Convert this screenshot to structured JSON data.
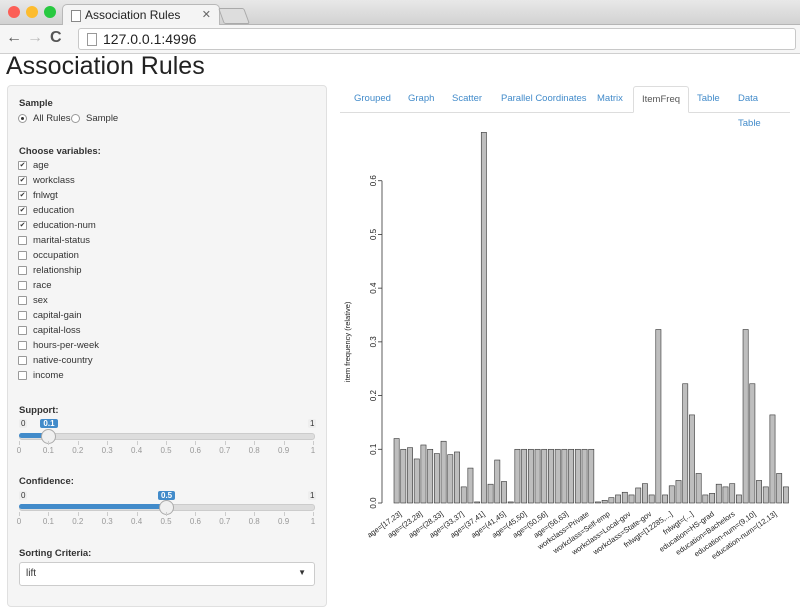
{
  "browser": {
    "tab_title": "Association Rules",
    "tab_close": "✕",
    "url": "127.0.0.1:4996",
    "back": "←",
    "forward": "→",
    "reload": "C"
  },
  "page_title": "Association Rules",
  "sidebar": {
    "sample": {
      "label": "Sample",
      "options": [
        "All Rules",
        "Sample"
      ],
      "selected": "All Rules"
    },
    "variables": {
      "label": "Choose variables:",
      "items": [
        {
          "label": "age",
          "checked": true
        },
        {
          "label": "workclass",
          "checked": true
        },
        {
          "label": "fnlwgt",
          "checked": true
        },
        {
          "label": "education",
          "checked": true
        },
        {
          "label": "education-num",
          "checked": true
        },
        {
          "label": "marital-status",
          "checked": false
        },
        {
          "label": "occupation",
          "checked": false
        },
        {
          "label": "relationship",
          "checked": false
        },
        {
          "label": "race",
          "checked": false
        },
        {
          "label": "sex",
          "checked": false
        },
        {
          "label": "capital-gain",
          "checked": false
        },
        {
          "label": "capital-loss",
          "checked": false
        },
        {
          "label": "hours-per-week",
          "checked": false
        },
        {
          "label": "native-country",
          "checked": false
        },
        {
          "label": "income",
          "checked": false
        }
      ]
    },
    "support": {
      "label": "Support:",
      "min": "0",
      "max": "1",
      "value": "0.1",
      "value_num": 0.1
    },
    "confidence": {
      "label": "Confidence:",
      "min": "0",
      "max": "1",
      "value": "0.5",
      "value_num": 0.5
    },
    "tick_labels": [
      "0",
      "0.1",
      "0.2",
      "0.3",
      "0.4",
      "0.5",
      "0.6",
      "0.7",
      "0.8",
      "0.9",
      "1"
    ],
    "sorting": {
      "label": "Sorting Criteria:",
      "value": "lift"
    }
  },
  "tabs": [
    {
      "label": "Grouped",
      "active": false
    },
    {
      "label": "Graph",
      "active": false
    },
    {
      "label": "Scatter",
      "active": false
    },
    {
      "label": "Parallel Coordinates",
      "active": false
    },
    {
      "label": "Matrix",
      "active": false
    },
    {
      "label": "ItemFreq",
      "active": true
    },
    {
      "label": "Table",
      "active": false
    },
    {
      "label": "Data Table",
      "active": false
    }
  ],
  "chart_data": {
    "type": "bar",
    "ylabel": "item frequency (relative)",
    "ylim": [
      0,
      0.7
    ],
    "yticks": [
      "0.0",
      "0.1",
      "0.2",
      "0.3",
      "0.4",
      "0.5",
      "0.6"
    ],
    "xticklabels": [
      "age=[17,23]",
      "age=(23,28]",
      "age=(28,33]",
      "age=(33,37]",
      "age=(37,41]",
      "age=(41,45]",
      "age=(45,50]",
      "age=(50,56]",
      "age=(56,63]",
      "workclass=Private",
      "workclass=Self-emp",
      "workclass=Local-gov",
      "workclass=State-gov",
      "fnlwgt=[12285,...]",
      "fnlwgt=(...]",
      "education=HS-grad",
      "education=Bachelors",
      "education-num=(9,10]",
      "education-num=(12,13]"
    ],
    "values": [
      0.12,
      0.1,
      0.103,
      0.082,
      0.108,
      0.1,
      0.092,
      0.115,
      0.09,
      0.095,
      0.03,
      0.065,
      0.002,
      0.69,
      0.035,
      0.08,
      0.04,
      0.002,
      0.1,
      0.1,
      0.1,
      0.1,
      0.1,
      0.1,
      0.1,
      0.1,
      0.1,
      0.1,
      0.1,
      0.1,
      0.002,
      0.005,
      0.01,
      0.015,
      0.02,
      0.015,
      0.028,
      0.036,
      0.015,
      0.323,
      0.015,
      0.032,
      0.042,
      0.222,
      0.164,
      0.055,
      0.015,
      0.018,
      0.035,
      0.03,
      0.036,
      0.015,
      0.323,
      0.222,
      0.042,
      0.03,
      0.164,
      0.055,
      0.03
    ]
  }
}
